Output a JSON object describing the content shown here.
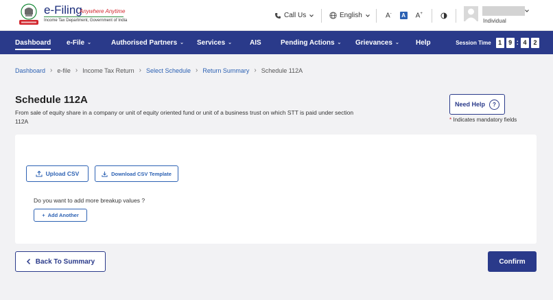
{
  "brand": {
    "title": "e-Filing",
    "tagline": "Anywhere Anytime",
    "subtitle": "Income Tax Department, Government of India"
  },
  "utility": {
    "call_us": "Call Us",
    "language": "English",
    "font_decrease": "A",
    "font_normal": "A",
    "font_increase": "A",
    "user_role": "Individual"
  },
  "nav": {
    "items": [
      {
        "label": "Dashboard",
        "active": true
      },
      {
        "label": "e-File",
        "caret": "⌄"
      },
      {
        "label": "Authorised Partners",
        "caret": "⌄"
      },
      {
        "label": "Services",
        "caret": "⌄"
      },
      {
        "label": "AIS"
      },
      {
        "label": "Pending Actions",
        "caret": "⌄"
      },
      {
        "label": "Grievances",
        "caret": "⌄"
      },
      {
        "label": "Help"
      }
    ],
    "session_label": "Session Time",
    "session_digits": [
      "1",
      "9",
      "4",
      "2"
    ]
  },
  "breadcrumb": [
    {
      "label": "Dashboard",
      "link": true
    },
    {
      "label": "e-file",
      "link": false
    },
    {
      "label": "Income Tax Return",
      "link": false
    },
    {
      "label": "Select Schedule",
      "link": true
    },
    {
      "label": "Return Summary",
      "link": true
    },
    {
      "label": "Schedule 112A",
      "link": false
    }
  ],
  "page": {
    "title": "Schedule 112A",
    "description": "From sale of equity share in a company or unit of equity oriented fund or unit of a business trust on which STT is paid under section 112A",
    "need_help": "Need Help",
    "help_symbol": "?",
    "mandatory_star": "*",
    "mandatory_note": "Indicates mandatory fields"
  },
  "card": {
    "upload_csv": "Upload CSV",
    "download_template": "Download CSV Template",
    "question": "Do you want to add more breakup values ?",
    "add_another": "Add Another",
    "add_symbol": "+"
  },
  "footer": {
    "back": "Back To Summary",
    "confirm": "Confirm"
  },
  "colors": {
    "primary": "#2a3a8a",
    "link": "#2c61b3",
    "background": "#f2f2f4",
    "required": "#d2282f"
  }
}
